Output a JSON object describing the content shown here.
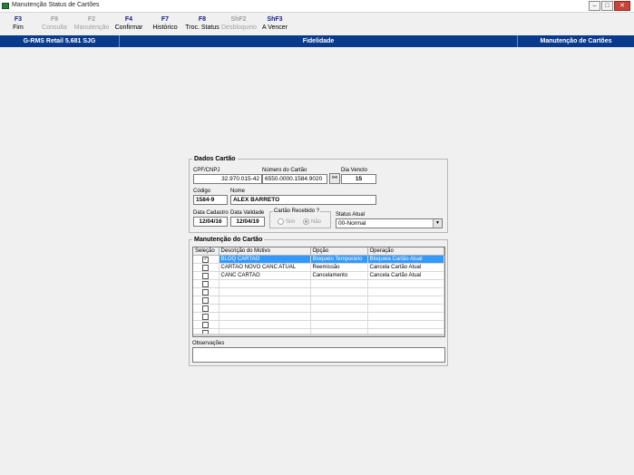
{
  "window": {
    "title": "Manutenção Status de Cartões"
  },
  "toolbar": [
    {
      "key": "F3",
      "label": "Fim",
      "enabled": true
    },
    {
      "key": "F9",
      "label": "Consulta",
      "enabled": false
    },
    {
      "key": "F2",
      "label": "Manutenção",
      "enabled": false
    },
    {
      "key": "F4",
      "label": "Confirmar",
      "enabled": true
    },
    {
      "key": "F7",
      "label": "Histórico",
      "enabled": true
    },
    {
      "key": "F8",
      "label": "Troc. Status",
      "enabled": true
    },
    {
      "key": "ShF2",
      "label": "Desbloqueio",
      "enabled": false
    },
    {
      "key": "ShF3",
      "label": "A Vencer",
      "enabled": true
    }
  ],
  "header": {
    "app": "G-RMS Retail 5.681 SJG",
    "module": "Fidelidade",
    "screen": "Manutenção de Cartões"
  },
  "dados": {
    "title": "Dados Cartão",
    "cpf_label": "CPF/CNPJ",
    "cpf_value": "32.970.015-42",
    "numero_label": "Número do Cartão",
    "numero_value": "6550.0000.1584.9020",
    "dia_label": "Dia Vencto",
    "dia_value": "15",
    "codigo_label": "Código",
    "codigo_value": "1584-9",
    "nome_label": "Nome",
    "nome_value": "ALEX BARRETO",
    "cadastro_label": "Data Cadastro",
    "cadastro_value": "12/04/16",
    "validade_label": "Data Validade",
    "validade_value": "12/04/19",
    "recebido_label": "Cartão Recebido ?",
    "sim_label": "Sim",
    "nao_label": "Não",
    "status_label": "Status Atual",
    "status_value": "00-Normal"
  },
  "manutencao": {
    "title": "Manutenção do Cartão",
    "columns": [
      "Seleção",
      "Descrição do Motivo",
      "Opção",
      "Operação"
    ],
    "rows": [
      {
        "check": "✓",
        "motivo": "BLOQ CARTAO",
        "opcao": "Bloqueio Temporário",
        "operacao": "Bloqueia Cartão Atual"
      },
      {
        "check": "",
        "motivo": "CARTAO NOVO CANC ATUAL",
        "opcao": "Reemissão",
        "operacao": "Cancela Cartão Atual"
      },
      {
        "check": "",
        "motivo": "CANC CARTAO",
        "opcao": "Cancelamento",
        "operacao": "Cancela Cartão Atual"
      },
      {
        "check": "",
        "motivo": "",
        "opcao": "",
        "operacao": ""
      },
      {
        "check": "",
        "motivo": "",
        "opcao": "",
        "operacao": ""
      },
      {
        "check": "",
        "motivo": "",
        "opcao": "",
        "operacao": ""
      },
      {
        "check": "",
        "motivo": "",
        "opcao": "",
        "operacao": ""
      },
      {
        "check": "",
        "motivo": "",
        "opcao": "",
        "operacao": ""
      },
      {
        "check": "",
        "motivo": "",
        "opcao": "",
        "operacao": ""
      },
      {
        "check": "",
        "motivo": "",
        "opcao": "",
        "operacao": ""
      }
    ],
    "obs_label": "Observações",
    "obs_value": ""
  }
}
